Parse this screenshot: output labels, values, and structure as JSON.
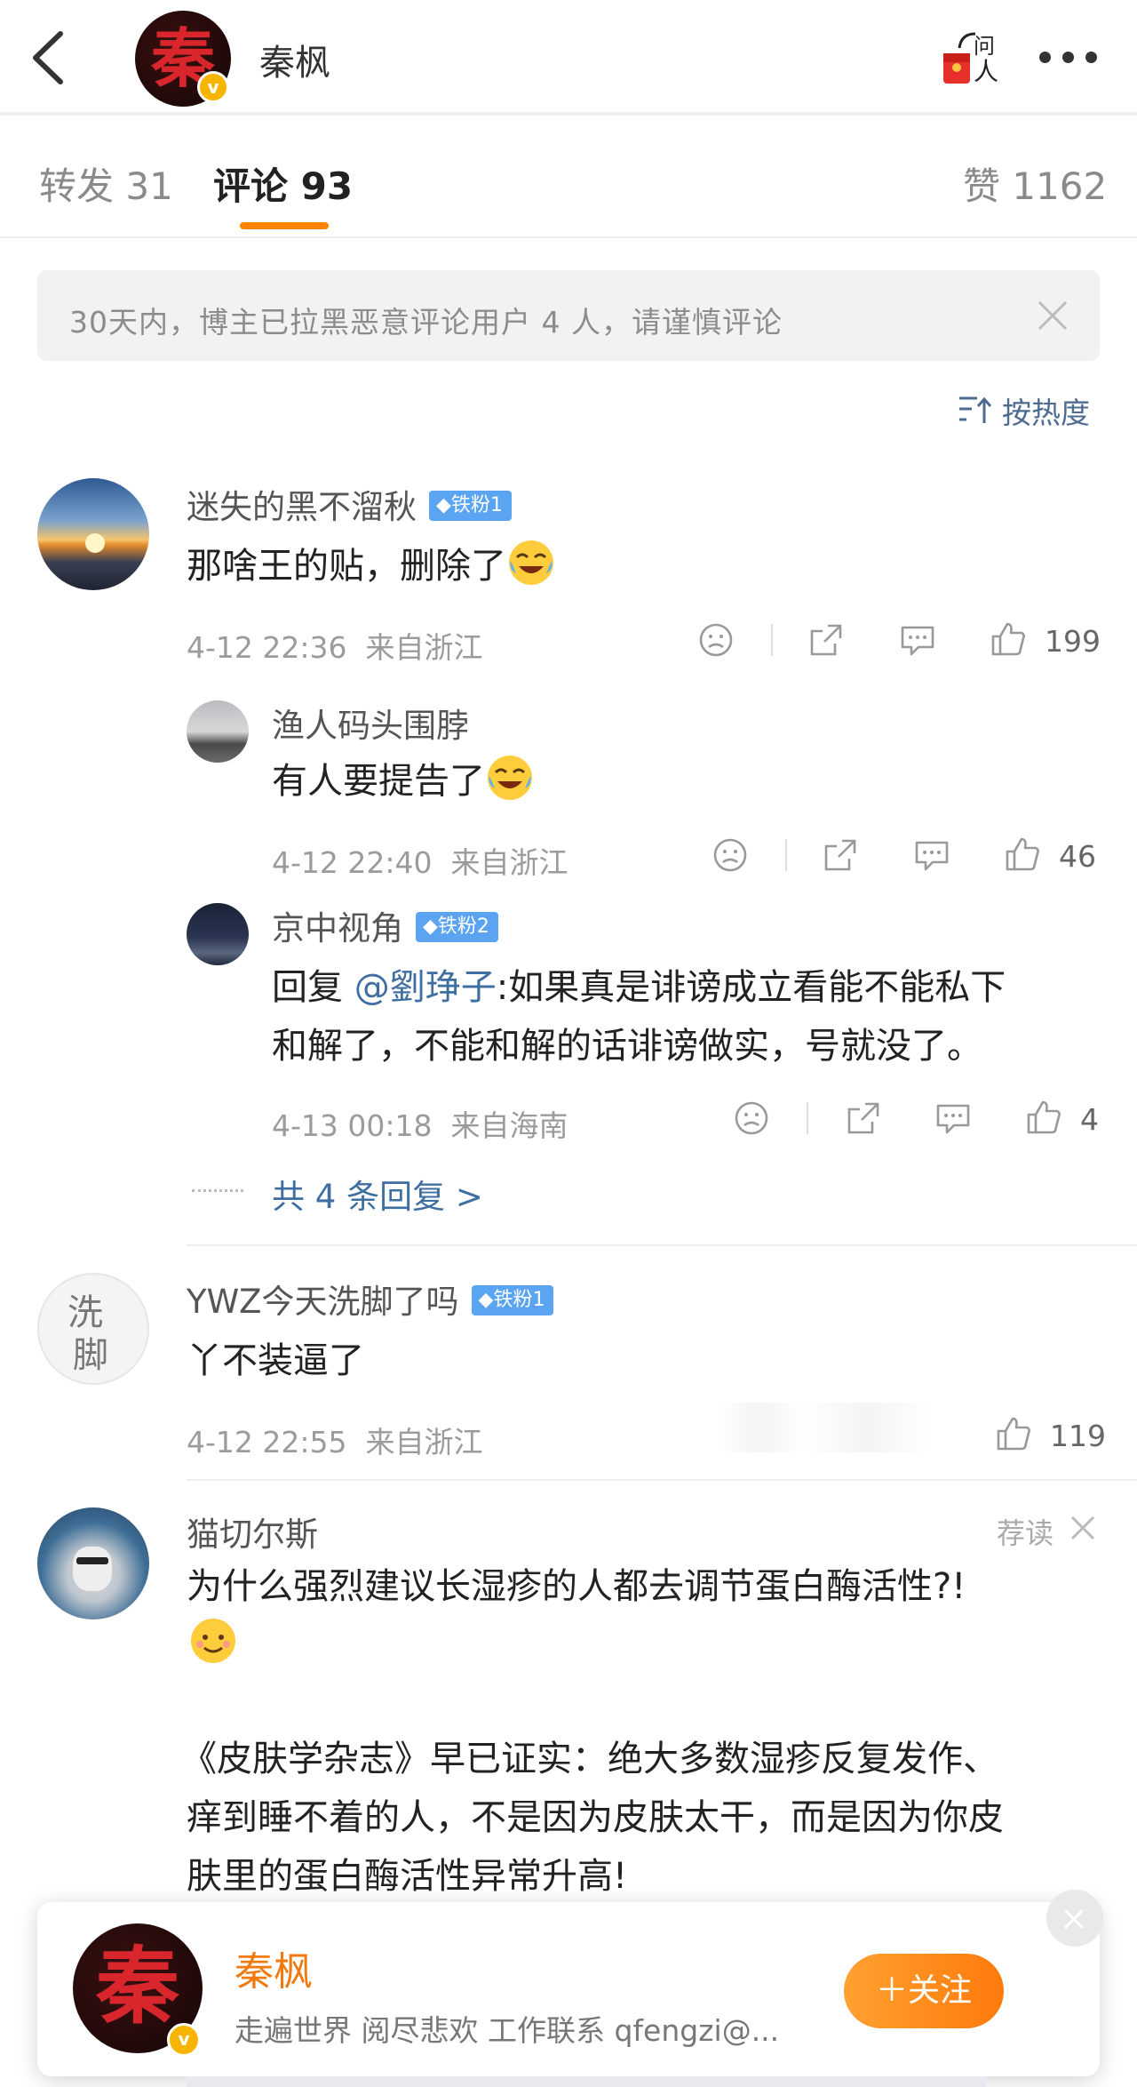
{
  "header": {
    "name": "秦枫",
    "avatar_glyph": "秦",
    "verified_glyph": "v",
    "ask_label_top": "问",
    "ask_label_bottom": "人"
  },
  "tabs": [
    {
      "label": "转发 31"
    },
    {
      "label": "评论 93"
    },
    {
      "label": "赞 1162"
    }
  ],
  "notice": {
    "text": "30天内，博主已拉黑恶意评论用户 4 人，请谨慎评论"
  },
  "sort": {
    "label": "按热度"
  },
  "comments": [
    {
      "user": "迷失的黑不溜秋",
      "badge": "◆铁粉1",
      "text": "那啥王的贴，删除了",
      "time": "4-12 22:36",
      "location": "来自浙江",
      "likes": "199",
      "replies": [
        {
          "user": "渔人码头围脖",
          "text": "有人要提告了",
          "time": "4-12 22:40",
          "location": "来自浙江",
          "likes": "46"
        },
        {
          "user": "京中视角",
          "badge": "◆铁粉2",
          "reply_prefix": "回复 ",
          "mention": "@劉琤子",
          "text_line1": ":如果真是诽谤成立看能不能私下",
          "text_line2": "和解了，不能和解的话诽谤做实，号就没了。",
          "time": "4-13 00:18",
          "location": "来自海南",
          "likes": "4"
        }
      ],
      "more_replies": "共 4 条回复 >"
    },
    {
      "user": "YWZ今天洗脚了吗",
      "badge": "◆铁粉1",
      "avatar_text_1": "洗",
      "avatar_text_2": "脚",
      "text": "丫不装逼了",
      "time": "4-12 22:55",
      "location": "来自浙江",
      "likes": "119"
    },
    {
      "user": "猫切尔斯",
      "rec_label": "荐读",
      "text_line1": "为什么强烈建议长湿疹的人都去调节蛋白酶活性?!",
      "text_line3": "《皮肤学杂志》早已证实：绝大多数湿疹反复发作、",
      "text_line4": "痒到睡不着的人，不是因为皮肤太干，而是因为你皮",
      "text_line5": "肤里的蛋白酶活性异常升高!"
    }
  ],
  "follow_card": {
    "name": "秦枫",
    "desc": "走遍世界 阅尽悲欢 工作联系 qfengzi@...",
    "button": "＋关注"
  },
  "colors": {
    "accent": "#ff8200",
    "link": "#3f6ea0",
    "badge": "#5aa4f2",
    "seal_red": "#d8262c"
  },
  "icons": [
    "back-icon",
    "ask-icon",
    "more-icon",
    "close-icon",
    "sort-icon",
    "dislike-icon",
    "share-icon",
    "comment-icon",
    "like-icon",
    "laugh-cry-emoji",
    "smile-emoji"
  ]
}
